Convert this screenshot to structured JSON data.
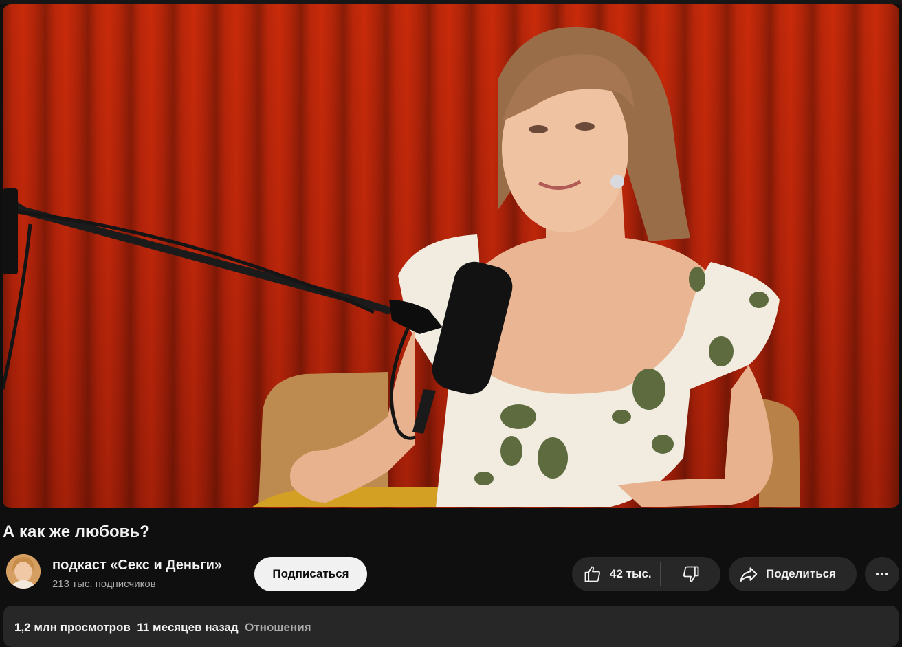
{
  "video": {
    "title": "А как же любовь?"
  },
  "channel": {
    "name": "подкаст «Секс и Деньги»",
    "subscribers": "213 тыс. подписчиков"
  },
  "actions": {
    "subscribe_label": "Подписаться",
    "like_count": "42 тыс.",
    "share_label": "Поделиться"
  },
  "description": {
    "views": "1,2 млн просмотров",
    "published": "11 месяцев назад",
    "tag": "Отношения"
  },
  "colors": {
    "background": "#0f0f0f",
    "button_bg": "#272727",
    "subscribe_bg": "#f1f1f1",
    "text_primary": "#f1f1f1",
    "text_secondary": "#aaaaaa",
    "curtain_red": "#c5290a"
  },
  "icons": {
    "like": "thumbs-up-icon",
    "dislike": "thumbs-down-icon",
    "share": "share-arrow-icon",
    "more": "more-horizontal-icon"
  }
}
